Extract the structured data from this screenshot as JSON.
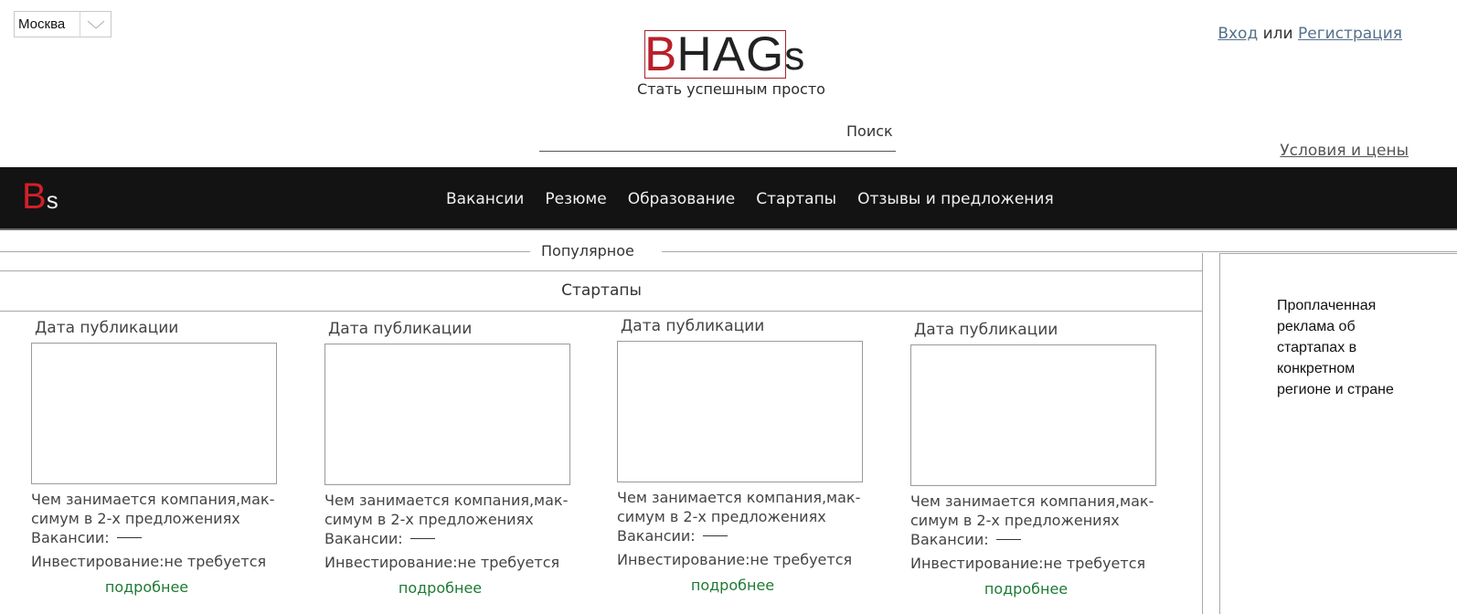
{
  "city": {
    "value": "Москва",
    "toggle_icon": "chevron-down-icon"
  },
  "brand": {
    "logo_b": "B",
    "logo_hag": "HAG",
    "logo_s": "s",
    "tagline": "Стать успешным просто",
    "nav_logo_b": "B",
    "nav_logo_s": "s",
    "accent": "#d21f28"
  },
  "search": {
    "label": "Поиск",
    "value": ""
  },
  "auth": {
    "login": "Вход",
    "or": "или",
    "register": "Регистрация"
  },
  "terms": "Условия и цены",
  "nav": {
    "items": [
      "Вакансии",
      "Резюме",
      "Образование",
      "Стартапы",
      "Отзывы и предложения"
    ]
  },
  "popular": {
    "label": "Популярное"
  },
  "startups": {
    "title": "Стартапы",
    "cards": [
      {
        "date": "Дата публикации",
        "desc": "Чем занимается компания,мак-симум в 2-х предложениях",
        "vacancies": "Вакансии:",
        "investment": "Инвестирование:не требуется",
        "more": "подробнее"
      },
      {
        "date": "Дата публикации",
        "desc": "Чем занимается компания,мак-симум в 2-х предложениях",
        "vacancies": "Вакансии:",
        "investment": "Инвестирование:не требуется",
        "more": "подробнее"
      },
      {
        "date": "Дата публикации",
        "desc": "Чем занимается компания,мак-симум в 2-х предложениях",
        "vacancies": "Вакансии:",
        "investment": "Инвестирование:не требуется",
        "more": "подробнее"
      },
      {
        "date": "Дата публикации",
        "desc": "Чем занимается компания,мак-симум в 2-х предложениях",
        "vacancies": "Вакансии:",
        "investment": "Инвестирование:не требуется",
        "more": "подробнее"
      }
    ]
  },
  "ad": {
    "text": "Проплаченная реклама об стартапах в конкретном регионе и стране"
  }
}
